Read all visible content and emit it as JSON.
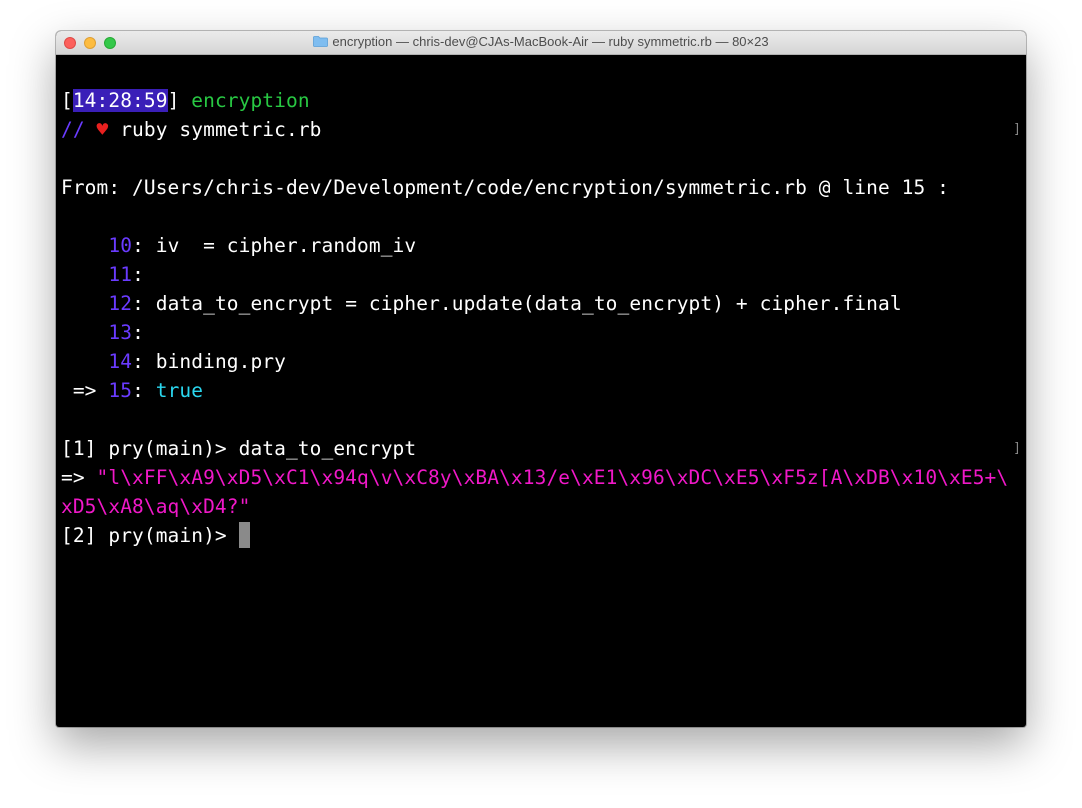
{
  "window": {
    "title": "encryption — chris-dev@CJAs-MacBook-Air — ruby symmetric.rb — 80×23",
    "icon": "folder-icon"
  },
  "prompt": {
    "time": "14:28:59",
    "directory": "encryption",
    "slashes": "//",
    "heart": "♥",
    "command": "ruby symmetric.rb"
  },
  "from_line": "From: /Users/chris-dev/Development/code/encryption/symmetric.rb @ line 15 :",
  "source": [
    {
      "arrow": "    ",
      "num": "10",
      "code": "iv  = cipher.random_iv"
    },
    {
      "arrow": "    ",
      "num": "11",
      "code": ""
    },
    {
      "arrow": "    ",
      "num": "12",
      "code": "data_to_encrypt = cipher.update(data_to_encrypt) + cipher.final"
    },
    {
      "arrow": "    ",
      "num": "13",
      "code": ""
    },
    {
      "arrow": "    ",
      "num": "14",
      "code": "binding.pry"
    },
    {
      "arrow": " => ",
      "num": "15",
      "code": "true"
    }
  ],
  "pry": {
    "prompt1": "[1] pry(main)> ",
    "input1": "data_to_encrypt",
    "result_arrow": "=> ",
    "result_line1": "\"l\\xFF\\xA9\\xD5\\xC1\\x94q\\v\\xC8y\\xBA\\x13/e\\xE1\\x96\\xDC\\xE5\\xF5z[A\\xDB\\x10\\xE5+\\",
    "result_line2": "xD5\\xA8\\aq\\xD4?\"",
    "prompt2": "[2] pry(main)> "
  },
  "colors": {
    "green": "#28c843",
    "purple": "#6a3bff",
    "red": "#e8201f",
    "cyan": "#2ad6ee",
    "magenta": "#f018c8"
  }
}
